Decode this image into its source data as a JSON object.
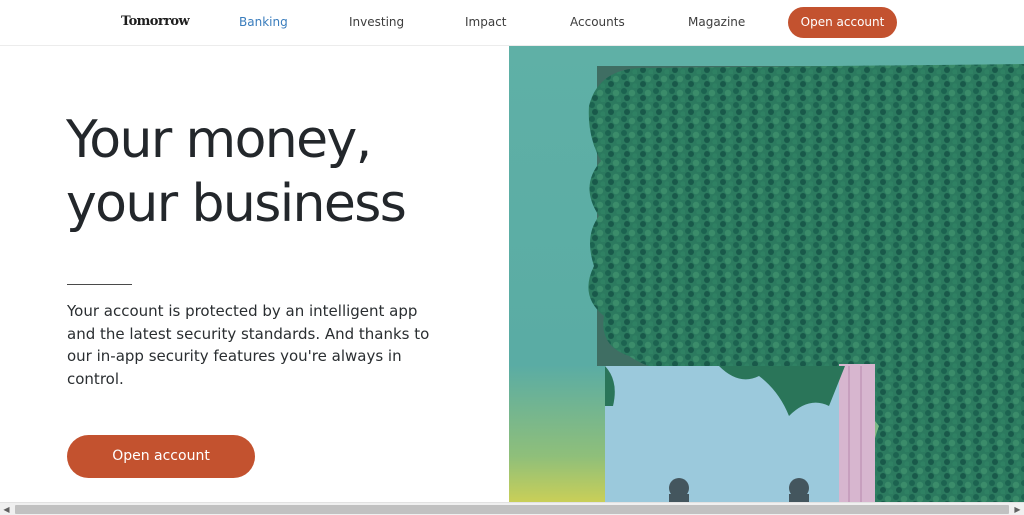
{
  "header": {
    "logo": "Tomorrow",
    "nav": [
      {
        "label": "Banking",
        "active": true
      },
      {
        "label": "Investing",
        "active": false
      },
      {
        "label": "Impact",
        "active": false
      },
      {
        "label": "Accounts",
        "active": false
      },
      {
        "label": "Magazine",
        "active": false
      }
    ],
    "cta_label": "Open account"
  },
  "hero": {
    "title_line1": "Your money,",
    "title_line2": "your business",
    "body": "Your account is protected by an intelligent app and the latest security standards. And thanks to our in-app security features you're always in control.",
    "cta_label": "Open account"
  },
  "colors": {
    "accent": "#c3522f",
    "active_nav": "#3a7dbd",
    "illustration_bg": "#5fb0a6",
    "ivy": "#1f6b55"
  },
  "icons": {
    "scroll_left": "◀",
    "scroll_right": "▶"
  }
}
